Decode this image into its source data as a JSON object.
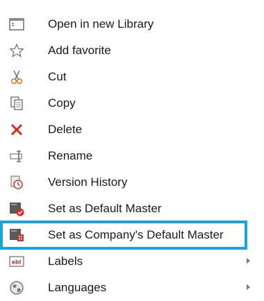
{
  "menu": {
    "items": [
      {
        "label": "Open in new Library",
        "icon": "window-icon"
      },
      {
        "label": "Add favorite",
        "icon": "star-icon"
      },
      {
        "label": "Cut",
        "icon": "scissors-icon"
      },
      {
        "label": "Copy",
        "icon": "copy-icon"
      },
      {
        "label": "Delete",
        "icon": "delete-x-icon"
      },
      {
        "label": "Rename",
        "icon": "rename-icon"
      },
      {
        "label": "Version History",
        "icon": "version-history-icon"
      },
      {
        "label": "Set as Default Master",
        "icon": "default-master-icon"
      },
      {
        "label": "Set as Company's Default Master",
        "icon": "company-default-master-icon",
        "highlighted": true
      },
      {
        "label": "Labels",
        "icon": "labels-icon",
        "submenu": true
      },
      {
        "label": "Languages",
        "icon": "globe-icon",
        "submenu": true
      }
    ]
  },
  "colors": {
    "highlight_border": "#1aa3d9",
    "delete_red": "#e2231a",
    "text": "#1a1a1a"
  }
}
